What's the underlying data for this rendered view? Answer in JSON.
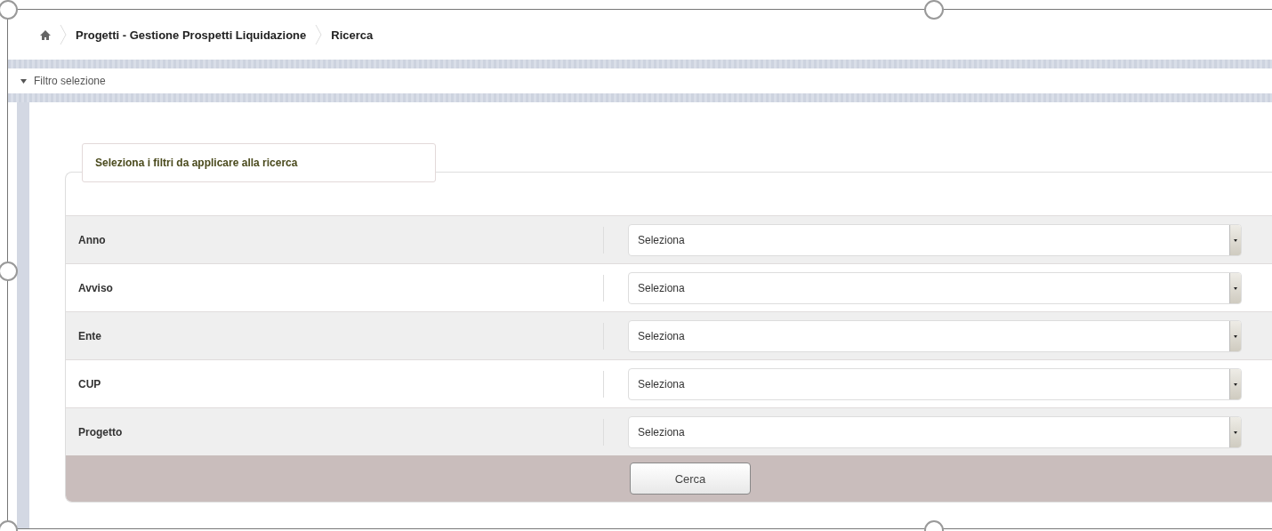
{
  "breadcrumb": [
    "Progetti - Gestione Prospetti Liquidazione",
    "Ricerca"
  ],
  "filter_panel": {
    "title": "Filtro selezione",
    "expanded": true
  },
  "fieldset": {
    "legend": "Seleziona i filtri da applicare alla ricerca",
    "fields": [
      {
        "label": "Anno",
        "value": "Seleziona"
      },
      {
        "label": "Avviso",
        "value": "Seleziona"
      },
      {
        "label": "Ente",
        "value": "Seleziona"
      },
      {
        "label": "CUP",
        "value": "Seleziona"
      },
      {
        "label": "Progetto",
        "value": "Seleziona"
      }
    ],
    "button": "Cerca"
  }
}
